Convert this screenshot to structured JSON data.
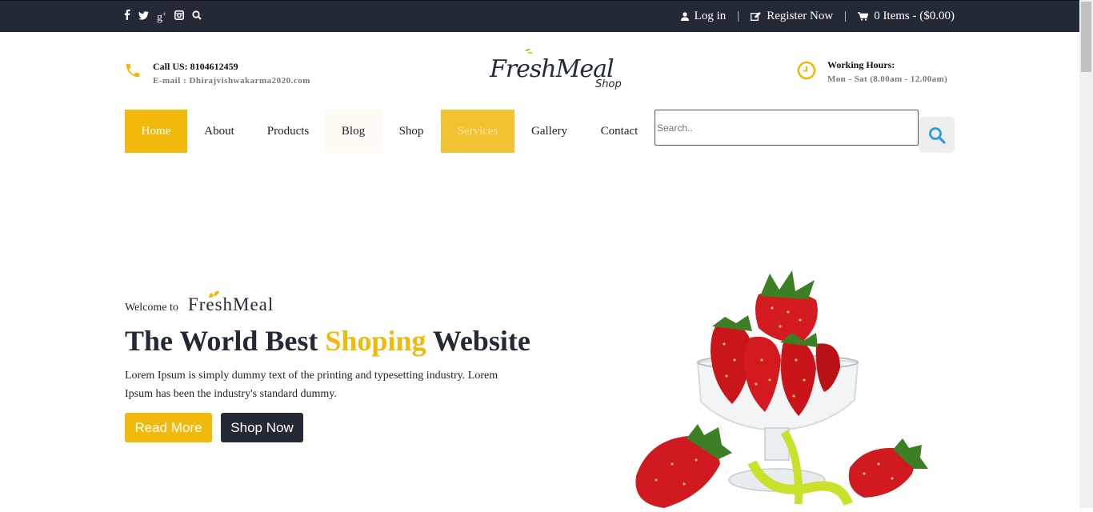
{
  "topbar": {
    "social_icons": [
      "facebook-icon",
      "twitter-icon",
      "google-plus-icon",
      "instagram-icon",
      "search-icon"
    ],
    "login_label": "Log in",
    "register_label": "Register Now",
    "cart_label": "0 Items - ($0.00)",
    "separator": "|"
  },
  "header": {
    "call_label": "Call US: 8104612459",
    "email_label": "E-mail : Dhirajvishwakarma2020.com",
    "logo_main": "FreshMeal",
    "logo_sub": "Shop",
    "hours_title": "Working Hours:",
    "hours_value": "Mon - Sat (8.00am - 12.00am)"
  },
  "nav": {
    "items": [
      {
        "label": "Home",
        "bg": "#f0b90b",
        "color": "#ffffff"
      },
      {
        "label": "About",
        "bg": "#ffffff",
        "color": "#222222"
      },
      {
        "label": "Products",
        "bg": "#ffffff",
        "color": "#222222"
      },
      {
        "label": "Blog",
        "bg": "#fdfaf3",
        "color": "#222222"
      },
      {
        "label": "Shop",
        "bg": "#ffffff",
        "color": "#222222"
      },
      {
        "label": "Services",
        "bg": "#f1c232",
        "color": "#f7e6a6"
      },
      {
        "label": "Gallery",
        "bg": "#ffffff",
        "color": "#222222"
      },
      {
        "label": "Contact",
        "bg": "#ffffff",
        "color": "#222222"
      }
    ],
    "search_placeholder": "Search.."
  },
  "hero": {
    "welcome_to": "Welcome to",
    "brand": "FreshMeal",
    "headline_1": "The World Best ",
    "headline_highlight": "Shoping",
    "headline_2": " Website",
    "description": "Lorem Ipsum is simply dummy text of the printing and typesetting industry. Lorem Ipsum has been the industry's standard dummy.",
    "read_more_label": "Read More",
    "shop_now_label": "Shop Now"
  },
  "colors": {
    "accent": "#f0b90b",
    "dark": "#232a36"
  }
}
